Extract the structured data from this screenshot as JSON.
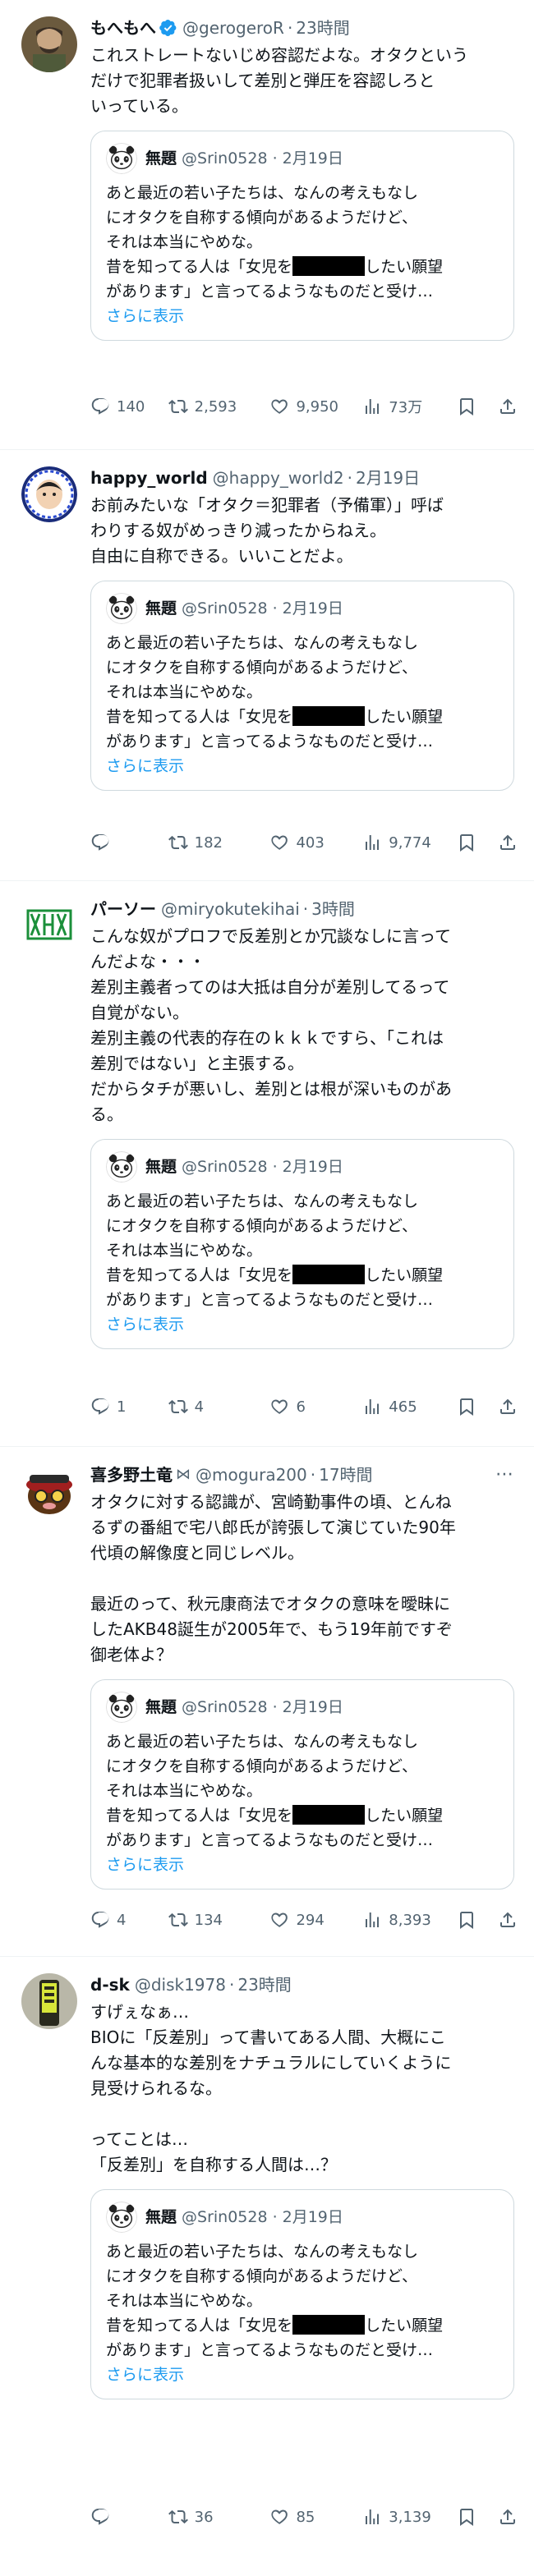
{
  "quote": {
    "name": "無題",
    "handle": "@Srin0528",
    "time": "2月19日",
    "line1": "あと最近の若い子たちは、なんの考えもなし",
    "line2": "にオタクを自称する傾向があるようだけど、",
    "line3": "それは本当にやめな。",
    "line4a": "昔を知ってる人は「女児を",
    "line4b": "したい願望",
    "line5": "があります」と言ってるようなものだと受け…",
    "show_more": "さらに表示"
  },
  "posts": [
    {
      "name": "もへもへ",
      "verified": true,
      "handle": "@gerogeroR",
      "dot": "·",
      "time": "23時間",
      "body": "これストレートないじめ容認だよな。オタクという\nだけで犯罪者扱いして差別と弾圧を容認しろと\nいっている。",
      "reply": "140",
      "retweet": "2,593",
      "like": "9,950",
      "views": "73万"
    },
    {
      "name": "happy_world",
      "handle": "@happy_world2",
      "dot": "·",
      "time": "2月19日",
      "body": "お前みたいな「オタク＝犯罪者（予備軍）」呼ば\nわりする奴がめっきり減ったからねえ。\n自由に自称できる。いいことだよ。",
      "reply": "",
      "retweet": "182",
      "like": "403",
      "views": "9,774"
    },
    {
      "name": "パーソー",
      "handle": "@miryokutekihai",
      "dot": "·",
      "time": "3時間",
      "body": "こんな奴がプロフで反差別とか冗談なしに言って\nんだよな・・・\n差別主義者ってのは大抵は自分が差別してるって\n自覚がない。\n差別主義の代表的存在のｋｋｋですら、「これは\n差別ではない」と主張する。\nだからタチが悪いし、差別とは根が深いものがあ\nる。",
      "reply": "1",
      "retweet": "4",
      "like": "6",
      "views": "465"
    },
    {
      "name": "喜多野土竜",
      "handle": "@mogura200",
      "dot": "·",
      "time": "17時間",
      "body": "オタクに対する認識が、宮崎勤事件の頃、とんね\nるずの番組で宅八郎氏が誇張して演じていた90年\n代頃の解像度と同じレベル。\n\n最近のって、秋元康商法でオタクの意味を曖昧に\nしたAKB48誕生が2005年で、もう19年前ですぞ\n御老体よ？",
      "reply": "4",
      "retweet": "134",
      "like": "294",
      "views": "8,393"
    },
    {
      "name": "d-sk",
      "handle": "@disk1978",
      "dot": "·",
      "time": "23時間",
      "body": "すげぇなぁ…\nBIOに「反差別」って書いてある人間、大概にこ\nんな基本的な差別をナチュラルにしていくように\n見受けられるな。\n\nってことは…\n「反差別」を自称する人間は…？",
      "reply": "",
      "retweet": "36",
      "like": "85",
      "views": "3,139"
    }
  ],
  "colors": {
    "text": "#0f1419",
    "muted": "#536471",
    "link": "#1d9bf0",
    "verified": "#1d9bf0",
    "border": "#cfd9de"
  },
  "icons": [
    "reply-icon",
    "retweet-icon",
    "like-icon",
    "views-icon",
    "bookmark-icon",
    "share-icon",
    "verified-badge-icon",
    "more-icon"
  ]
}
